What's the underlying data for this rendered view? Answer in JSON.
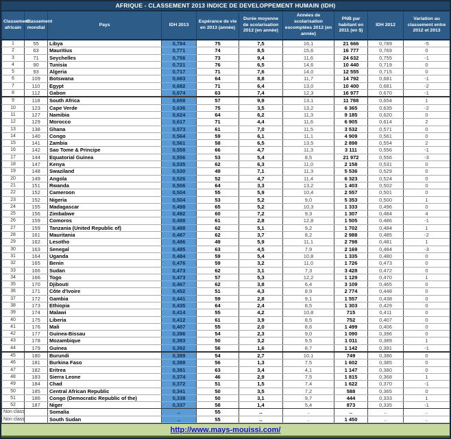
{
  "chart_data": {
    "type": "table",
    "title": "AFRIQUE - CLASSEMENT 2013 INDICE DE DEVELOPPEMENT HUMAIN (IDH)",
    "columns": [
      "Classement africain",
      "Classement mondial",
      "Pays",
      "IDH 2013",
      "Espérance de vie en 2013 (année)",
      "Durée moyenne de scolarisation 2012 (en année)",
      "Années de scolarisation escomptées 2012 (en année)",
      "PNB par habitant  en 2011 (en $)",
      "IDH 2012",
      "Variation au classement entre 2012 et 2013"
    ],
    "rows": [
      [
        "1",
        "55",
        "Libya",
        "0,784",
        "75",
        "7,5",
        "16,1",
        "21 666",
        "0,789",
        "-5"
      ],
      [
        "2",
        "63",
        "Mauritius",
        "0,771",
        "74",
        "8,5",
        "15,6",
        "16 777",
        "0,769",
        "0"
      ],
      [
        "3",
        "71",
        "Seychelles",
        "0,756",
        "73",
        "9,4",
        "11,6",
        "24 632",
        "0,755",
        "-1"
      ],
      [
        "4",
        "90",
        "Tunisia",
        "0,721",
        "76",
        "6,5",
        "14,6",
        "10 440",
        "0,719",
        "0"
      ],
      [
        "5",
        "93",
        "Algeria",
        "0,717",
        "71",
        "7,6",
        "14,0",
        "12 555",
        "0,715",
        "0"
      ],
      [
        "6",
        "109",
        "Botswana",
        "0,683",
        "64",
        "8,8",
        "11,7",
        "14 792",
        "0,681",
        "-1"
      ],
      [
        "7",
        "110",
        "Egypt",
        "0,682",
        "71",
        "6,4",
        "13,0",
        "10 400",
        "0,681",
        "-2"
      ],
      [
        "8",
        "112",
        "Gabon",
        "0,674",
        "63",
        "7,4",
        "12,3",
        "16 977",
        "0,670",
        "-1"
      ],
      [
        "9",
        "118",
        "South Africa",
        "0,658",
        "57",
        "9,9",
        "13,1",
        "11 788",
        "0,654",
        "1"
      ],
      [
        "10",
        "123",
        "Cape Verde",
        "0,636",
        "75",
        "3,5",
        "13,2",
        "6 365",
        "0,635",
        "-2"
      ],
      [
        "11",
        "127",
        "Namibia",
        "0,624",
        "64",
        "6,2",
        "11,3",
        "9 185",
        "0,620",
        "0"
      ],
      [
        "12",
        "129",
        "Morocco",
        "0,617",
        "71",
        "4,4",
        "11,6",
        "6 905",
        "0,614",
        "2"
      ],
      [
        "13",
        "138",
        "Ghana",
        "0,573",
        "61",
        "7,0",
        "11,5",
        "3 532",
        "0,571",
        "0"
      ],
      [
        "14",
        "140",
        "Congo",
        "0,564",
        "59",
        "6,1",
        "11,1",
        "4 909",
        "0,561",
        "0"
      ],
      [
        "15",
        "141",
        "Zambia",
        "0,561",
        "58",
        "6,5",
        "13,5",
        "2 898",
        "0,554",
        "2"
      ],
      [
        "16",
        "142",
        "Sao Tome & Principe",
        "0,558",
        "66",
        "4,7",
        "11,3",
        "3 111",
        "0,556",
        "-1"
      ],
      [
        "17",
        "144",
        "Equatorial Guinea",
        "0,556",
        "53",
        "5,4",
        "8,5",
        "21 972",
        "0,556",
        "-3"
      ],
      [
        "18",
        "147",
        "Kenya",
        "0,535",
        "62",
        "6,3",
        "11,0",
        "2 158",
        "0,531",
        "0"
      ],
      [
        "19",
        "148",
        "Swaziland",
        "0,530",
        "49",
        "7,1",
        "11,3",
        "5 536",
        "0,529",
        "0"
      ],
      [
        "20",
        "149",
        "Angola",
        "0,526",
        "52",
        "4,7",
        "11,4",
        "6 323",
        "0,524",
        "0"
      ],
      [
        "21",
        "151",
        "Rwanda",
        "0,506",
        "64",
        "3,3",
        "13,2",
        "1 403",
        "0,502",
        "0"
      ],
      [
        "22",
        "152",
        "Cameroon",
        "0,504",
        "55",
        "5,9",
        "10,4",
        "2 557",
        "0,501",
        "0"
      ],
      [
        "23",
        "152",
        "Nigeria",
        "0,504",
        "53",
        "5,2",
        "9,0",
        "5 353",
        "0,500",
        "1"
      ],
      [
        "24",
        "155",
        "Madagascar",
        "0,498",
        "65",
        "5,2",
        "10,3",
        "1 333",
        "0,496",
        "0"
      ],
      [
        "25",
        "156",
        "Zimbabwe",
        "0,492",
        "60",
        "7,2",
        "9,3",
        "1 307",
        "0,484",
        "4"
      ],
      [
        "26",
        "159",
        "Comoros",
        "0,488",
        "61",
        "2,8",
        "12,8",
        "1 505",
        "0,486",
        "-1"
      ],
      [
        "27",
        "159",
        "Tanzania (United Republic of)",
        "0,488",
        "62",
        "5,1",
        "9,2",
        "1 702",
        "0,484",
        "1"
      ],
      [
        "28",
        "161",
        "Mauritania",
        "0,487",
        "62",
        "3,7",
        "8,2",
        "2 988",
        "0,485",
        "-2"
      ],
      [
        "29",
        "162",
        "Lesotho",
        "0,486",
        "49",
        "5,9",
        "11,1",
        "2 798",
        "0,481",
        "1"
      ],
      [
        "30",
        "163",
        "Senegal",
        "0,485",
        "63",
        "4,5",
        "7,9",
        "2 169",
        "0,484",
        "-3"
      ],
      [
        "31",
        "164",
        "Uganda",
        "0,484",
        "59",
        "5,4",
        "10,8",
        "1 335",
        "0,480",
        "0"
      ],
      [
        "32",
        "165",
        "Benin",
        "0,476",
        "59",
        "3,2",
        "11,0",
        "1 726",
        "0,473",
        "0"
      ],
      [
        "33",
        "166",
        "Sudan",
        "0,473",
        "62",
        "3,1",
        "7,3",
        "3 428",
        "0,472",
        "0"
      ],
      [
        "34",
        "166",
        "Togo",
        "0,473",
        "57",
        "5,3",
        "12,2",
        "1 129",
        "0,470",
        "1"
      ],
      [
        "35",
        "170",
        "Djibouti",
        "0,467",
        "62",
        "3,8",
        "6,4",
        "3 109",
        "0,465",
        "0"
      ],
      [
        "36",
        "171",
        "Côte d'Ivoire",
        "0,452",
        "51",
        "4,3",
        "8,9",
        "2 774",
        "0,448",
        "0"
      ],
      [
        "37",
        "172",
        "Gambia",
        "0,441",
        "59",
        "2,8",
        "9,1",
        "1 557",
        "0,438",
        "0"
      ],
      [
        "38",
        "173",
        "Ethiopia",
        "0,435",
        "64",
        "2,4",
        "8,5",
        "1 303",
        "0,429",
        "0"
      ],
      [
        "39",
        "174",
        "Malawi",
        "0,414",
        "55",
        "4,2",
        "10,8",
        "715",
        "0,411",
        "0"
      ],
      [
        "40",
        "175",
        "Liberia",
        "0,412",
        "61",
        "3,9",
        "8,5",
        "752",
        "0,407",
        "0"
      ],
      [
        "41",
        "176",
        "Mali",
        "0,407",
        "55",
        "2,0",
        "8,6",
        "1 499",
        "0,406",
        "0"
      ],
      [
        "42",
        "177",
        "Guinea-Bissau",
        "0,396",
        "54",
        "2,3",
        "9,0",
        "1 090",
        "0,396",
        "0"
      ],
      [
        "43",
        "178",
        "Mozambique",
        "0,393",
        "50",
        "3,2",
        "9,5",
        "1 011",
        "0,389",
        "1"
      ],
      [
        "44",
        "179",
        "Guinea",
        "0,392",
        "56",
        "1,6",
        "8,7",
        "1 142",
        "0,391",
        "-1"
      ],
      [
        "45",
        "180",
        "Burundi",
        "0,389",
        "54",
        "2,7",
        "10,1",
        "749",
        "0,386",
        "0"
      ],
      [
        "46",
        "181",
        "Burkina Faso",
        "0,388",
        "56",
        "1,3",
        "7,5",
        "1 602",
        "0,385",
        "0"
      ],
      [
        "47",
        "182",
        "Eritrea",
        "0,381",
        "63",
        "3,4",
        "4,1",
        "1 147",
        "0,380",
        "0"
      ],
      [
        "48",
        "183",
        "Sierra Leone",
        "0,374",
        "46",
        "2,9",
        "7,5",
        "1 815",
        "0,368",
        "1"
      ],
      [
        "49",
        "184",
        "Chad",
        "0,372",
        "51",
        "1,5",
        "7,4",
        "1 622",
        "0,370",
        "-1"
      ],
      [
        "50",
        "185",
        "Central African Republic",
        "0,341",
        "50",
        "3,5",
        "7,2",
        "588",
        "0,365",
        "0"
      ],
      [
        "51",
        "186",
        "Congo (Democratic Republic of the)",
        "0,338",
        "50",
        "3,1",
        "9,7",
        "444",
        "0,333",
        "1"
      ],
      [
        "52",
        "187",
        "Niger",
        "0,337",
        "58",
        "1,4",
        "5,4",
        "873",
        "0,335",
        "-1"
      ],
      [
        "Non classé",
        "",
        "Somalia",
        "..",
        "55",
        "..",
        "..",
        "..",
        "..",
        ".."
      ],
      [
        "Non classé",
        "",
        "South Sudan",
        "..",
        "55",
        "..",
        "..",
        "1 450",
        "..",
        ".."
      ]
    ],
    "footer_link": "http://www.mays-mouissi.com/"
  },
  "colors": {
    "title_bar": "#1F4568",
    "header_bg": "#2E5C88",
    "idh_col_bg": "#5B9BD5",
    "footer_bg": "#C5D89E",
    "link_blue": "#1111CC",
    "green_dark": "#4F6228"
  }
}
